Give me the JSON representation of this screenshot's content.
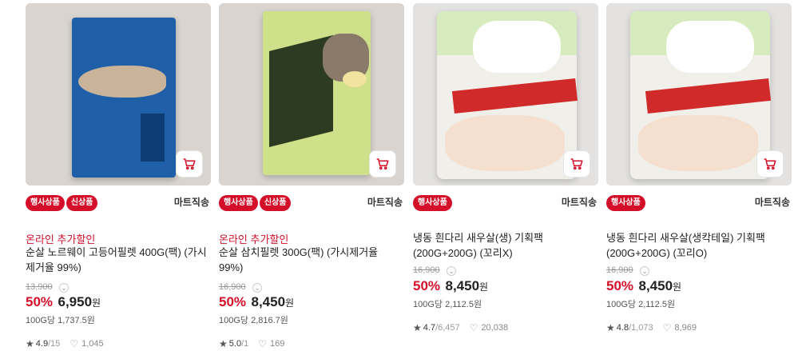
{
  "products": [
    {
      "badges": [
        "행사상품",
        "신상품"
      ],
      "delivery": "마트직송",
      "promo": "온라인 추가할인",
      "name": "순살 노르웨이 고등어필렛 400G(팩) (가시제거율 99%)",
      "original_price": "13,900",
      "discount": "50%",
      "price": "6,950",
      "won": "원",
      "unit_price": "100G당 1,737.5원",
      "rating": "4.9",
      "reviews": "/15",
      "likes": "1,045",
      "image_icon": "mackerel-fillet-package"
    },
    {
      "badges": [
        "행사상품",
        "신상품"
      ],
      "delivery": "마트직송",
      "promo": "온라인 추가할인",
      "name": "순살 삼치필렛 300G(팩) (가시제거율 99%)",
      "original_price": "16,900",
      "discount": "50%",
      "price": "8,450",
      "won": "원",
      "unit_price": "100G당 2,816.7원",
      "rating": "5.0",
      "reviews": "/1",
      "likes": "169",
      "image_icon": "spanish-mackerel-fillet-package"
    },
    {
      "badges": [
        "행사상품"
      ],
      "delivery": "마트직송",
      "promo": "",
      "name": "냉동 흰다리 새우살(생) 기획팩(200G+200G) (꼬리X)",
      "original_price": "16,900",
      "discount": "50%",
      "price": "8,450",
      "won": "원",
      "unit_price": "100G당 2,112.5원",
      "rating": "4.7",
      "reviews": "/6,457",
      "likes": "20,038",
      "image_icon": "frozen-shrimp-bag"
    },
    {
      "badges": [
        "행사상품"
      ],
      "delivery": "마트직송",
      "promo": "",
      "name": "냉동 흰다리 새우살(생칵테일) 기획팩(200G+200G) (꼬리O)",
      "original_price": "16,900",
      "discount": "50%",
      "price": "8,450",
      "won": "원",
      "unit_price": "100G당 2,112.5원",
      "rating": "4.8",
      "reviews": "/1,073",
      "likes": "8,969",
      "image_icon": "frozen-shrimp-cocktail-bag"
    }
  ],
  "icons": {
    "cart": "cart-icon",
    "star": "star-icon",
    "like": "heart-plus-icon",
    "chevron": "chevron-down-icon"
  },
  "colors": {
    "accent": "#d40f2a",
    "badge_bg": "#d40f2a",
    "text": "#222222",
    "muted": "#999999"
  }
}
